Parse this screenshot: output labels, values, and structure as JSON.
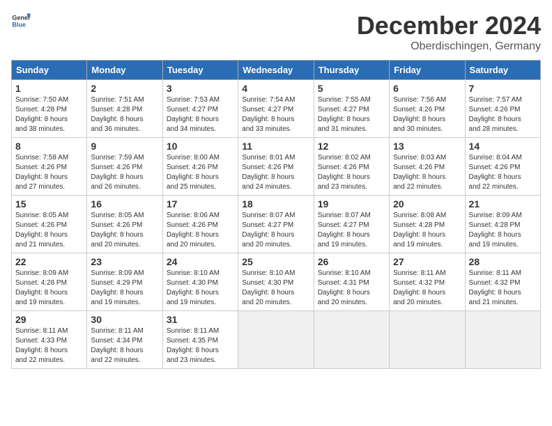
{
  "header": {
    "logo_general": "General",
    "logo_blue": "Blue",
    "month": "December 2024",
    "location": "Oberdischingen, Germany"
  },
  "days_of_week": [
    "Sunday",
    "Monday",
    "Tuesday",
    "Wednesday",
    "Thursday",
    "Friday",
    "Saturday"
  ],
  "weeks": [
    [
      {
        "day": 1,
        "lines": [
          "Sunrise: 7:50 AM",
          "Sunset: 4:28 PM",
          "Daylight: 8 hours",
          "and 38 minutes."
        ]
      },
      {
        "day": 2,
        "lines": [
          "Sunrise: 7:51 AM",
          "Sunset: 4:28 PM",
          "Daylight: 8 hours",
          "and 36 minutes."
        ]
      },
      {
        "day": 3,
        "lines": [
          "Sunrise: 7:53 AM",
          "Sunset: 4:27 PM",
          "Daylight: 8 hours",
          "and 34 minutes."
        ]
      },
      {
        "day": 4,
        "lines": [
          "Sunrise: 7:54 AM",
          "Sunset: 4:27 PM",
          "Daylight: 8 hours",
          "and 33 minutes."
        ]
      },
      {
        "day": 5,
        "lines": [
          "Sunrise: 7:55 AM",
          "Sunset: 4:27 PM",
          "Daylight: 8 hours",
          "and 31 minutes."
        ]
      },
      {
        "day": 6,
        "lines": [
          "Sunrise: 7:56 AM",
          "Sunset: 4:26 PM",
          "Daylight: 8 hours",
          "and 30 minutes."
        ]
      },
      {
        "day": 7,
        "lines": [
          "Sunrise: 7:57 AM",
          "Sunset: 4:26 PM",
          "Daylight: 8 hours",
          "and 28 minutes."
        ]
      }
    ],
    [
      {
        "day": 8,
        "lines": [
          "Sunrise: 7:58 AM",
          "Sunset: 4:26 PM",
          "Daylight: 8 hours",
          "and 27 minutes."
        ]
      },
      {
        "day": 9,
        "lines": [
          "Sunrise: 7:59 AM",
          "Sunset: 4:26 PM",
          "Daylight: 8 hours",
          "and 26 minutes."
        ]
      },
      {
        "day": 10,
        "lines": [
          "Sunrise: 8:00 AM",
          "Sunset: 4:26 PM",
          "Daylight: 8 hours",
          "and 25 minutes."
        ]
      },
      {
        "day": 11,
        "lines": [
          "Sunrise: 8:01 AM",
          "Sunset: 4:26 PM",
          "Daylight: 8 hours",
          "and 24 minutes."
        ]
      },
      {
        "day": 12,
        "lines": [
          "Sunrise: 8:02 AM",
          "Sunset: 4:26 PM",
          "Daylight: 8 hours",
          "and 23 minutes."
        ]
      },
      {
        "day": 13,
        "lines": [
          "Sunrise: 8:03 AM",
          "Sunset: 4:26 PM",
          "Daylight: 8 hours",
          "and 22 minutes."
        ]
      },
      {
        "day": 14,
        "lines": [
          "Sunrise: 8:04 AM",
          "Sunset: 4:26 PM",
          "Daylight: 8 hours",
          "and 22 minutes."
        ]
      }
    ],
    [
      {
        "day": 15,
        "lines": [
          "Sunrise: 8:05 AM",
          "Sunset: 4:26 PM",
          "Daylight: 8 hours",
          "and 21 minutes."
        ]
      },
      {
        "day": 16,
        "lines": [
          "Sunrise: 8:05 AM",
          "Sunset: 4:26 PM",
          "Daylight: 8 hours",
          "and 20 minutes."
        ]
      },
      {
        "day": 17,
        "lines": [
          "Sunrise: 8:06 AM",
          "Sunset: 4:26 PM",
          "Daylight: 8 hours",
          "and 20 minutes."
        ]
      },
      {
        "day": 18,
        "lines": [
          "Sunrise: 8:07 AM",
          "Sunset: 4:27 PM",
          "Daylight: 8 hours",
          "and 20 minutes."
        ]
      },
      {
        "day": 19,
        "lines": [
          "Sunrise: 8:07 AM",
          "Sunset: 4:27 PM",
          "Daylight: 8 hours",
          "and 19 minutes."
        ]
      },
      {
        "day": 20,
        "lines": [
          "Sunrise: 8:08 AM",
          "Sunset: 4:28 PM",
          "Daylight: 8 hours",
          "and 19 minutes."
        ]
      },
      {
        "day": 21,
        "lines": [
          "Sunrise: 8:09 AM",
          "Sunset: 4:28 PM",
          "Daylight: 8 hours",
          "and 19 minutes."
        ]
      }
    ],
    [
      {
        "day": 22,
        "lines": [
          "Sunrise: 8:09 AM",
          "Sunset: 4:28 PM",
          "Daylight: 8 hours",
          "and 19 minutes."
        ]
      },
      {
        "day": 23,
        "lines": [
          "Sunrise: 8:09 AM",
          "Sunset: 4:29 PM",
          "Daylight: 8 hours",
          "and 19 minutes."
        ]
      },
      {
        "day": 24,
        "lines": [
          "Sunrise: 8:10 AM",
          "Sunset: 4:30 PM",
          "Daylight: 8 hours",
          "and 19 minutes."
        ]
      },
      {
        "day": 25,
        "lines": [
          "Sunrise: 8:10 AM",
          "Sunset: 4:30 PM",
          "Daylight: 8 hours",
          "and 20 minutes."
        ]
      },
      {
        "day": 26,
        "lines": [
          "Sunrise: 8:10 AM",
          "Sunset: 4:31 PM",
          "Daylight: 8 hours",
          "and 20 minutes."
        ]
      },
      {
        "day": 27,
        "lines": [
          "Sunrise: 8:11 AM",
          "Sunset: 4:32 PM",
          "Daylight: 8 hours",
          "and 20 minutes."
        ]
      },
      {
        "day": 28,
        "lines": [
          "Sunrise: 8:11 AM",
          "Sunset: 4:32 PM",
          "Daylight: 8 hours",
          "and 21 minutes."
        ]
      }
    ],
    [
      {
        "day": 29,
        "lines": [
          "Sunrise: 8:11 AM",
          "Sunset: 4:33 PM",
          "Daylight: 8 hours",
          "and 22 minutes."
        ]
      },
      {
        "day": 30,
        "lines": [
          "Sunrise: 8:11 AM",
          "Sunset: 4:34 PM",
          "Daylight: 8 hours",
          "and 22 minutes."
        ]
      },
      {
        "day": 31,
        "lines": [
          "Sunrise: 8:11 AM",
          "Sunset: 4:35 PM",
          "Daylight: 8 hours",
          "and 23 minutes."
        ]
      },
      null,
      null,
      null,
      null
    ]
  ]
}
